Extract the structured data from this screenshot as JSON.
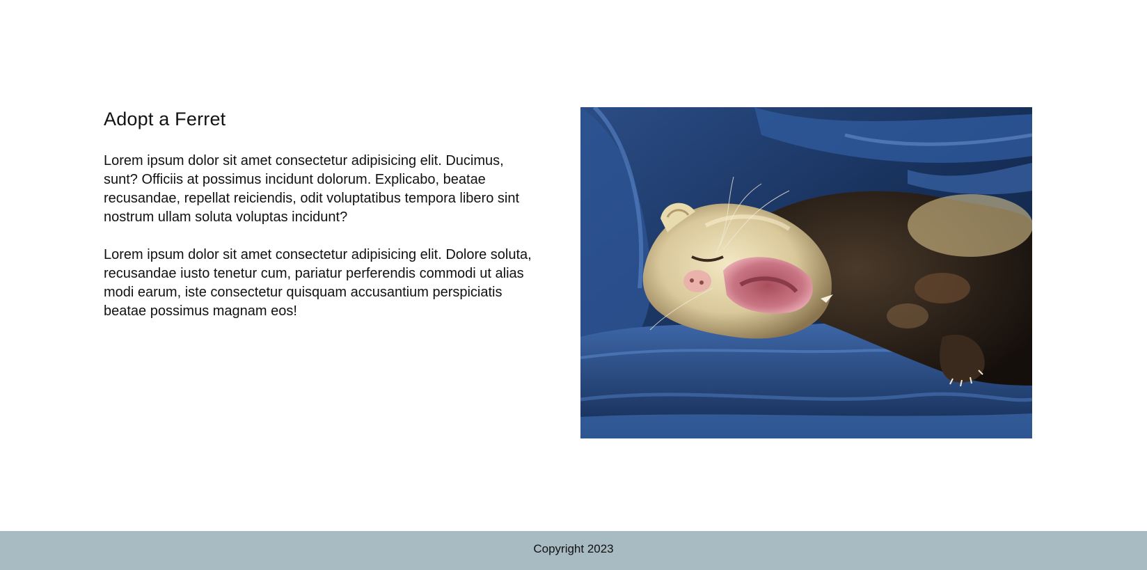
{
  "article": {
    "title": "Adopt a Ferret",
    "paragraphs": [
      "Lorem ipsum dolor sit amet consectetur adipisicing elit. Ducimus, sunt? Officiis at possimus incidunt dolorum. Explicabo, beatae recusandae, repellat reiciendis, odit voluptatibus tempora libero sint nostrum ullam soluta voluptas incidunt?",
      "Lorem ipsum dolor sit amet consectetur adipisicing elit. Dolore soluta, recusandae iusto tenetur cum, pariatur perferendis commodi ut alias modi earum, iste consectetur quisquam accusantium perspiciatis beatae possimus magnam eos!"
    ]
  },
  "photo": {
    "subject": "yawning ferret on blue satin",
    "colors": {
      "fabric": "#1d3a6b",
      "fur_light": "#e8dcae",
      "fur_dark": "#2a2018",
      "mouth": "#c46b78"
    }
  },
  "footer": {
    "copyright": "Copyright 2023",
    "background": "#a8bbc2"
  }
}
